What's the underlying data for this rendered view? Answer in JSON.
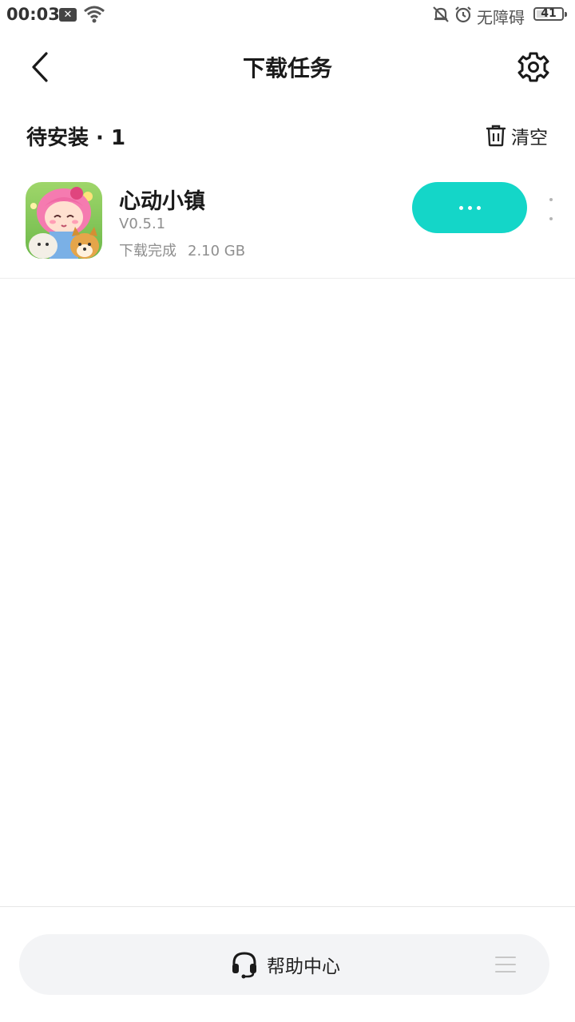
{
  "status_bar": {
    "time": "00:03",
    "accessibility": "无障碍",
    "battery": "41",
    "icons": [
      "notification-x-icon",
      "wifi-icon",
      "bell-muted-icon",
      "alarm-icon",
      "battery-icon"
    ]
  },
  "header": {
    "title": "下载任务",
    "back_icon": "chevron-left-icon",
    "settings_icon": "gear-icon"
  },
  "section": {
    "title": "待安装 · 1",
    "clear_label": "清空",
    "clear_icon": "trash-icon"
  },
  "tasks": [
    {
      "name": "心动小镇",
      "version": "V0.5.1",
      "status": "下载完成",
      "size": "2.10 GB",
      "action_icon": "ellipsis-icon",
      "more_icon": "more-vertical-icon"
    }
  ],
  "footer": {
    "help_label": "帮助中心",
    "help_icon": "headset-icon",
    "menu_icon": "menu-icon"
  },
  "colors": {
    "accent": "#14d6c8",
    "text_primary": "#1a1a1a",
    "text_secondary": "#8f8f8f",
    "footer_bg": "#f3f4f6"
  }
}
